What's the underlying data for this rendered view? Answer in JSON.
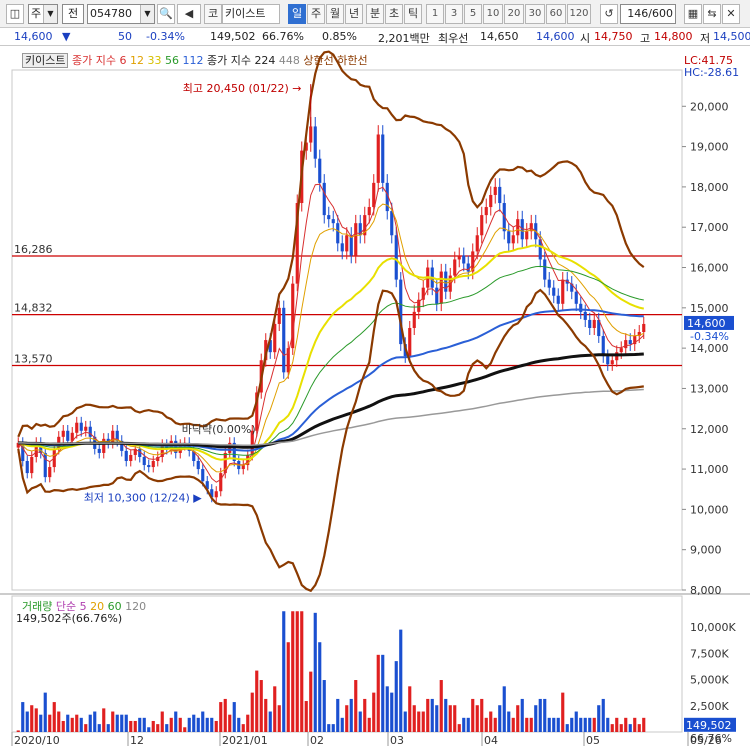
{
  "toolbar": {
    "icon_chart": "◫",
    "mode": "주",
    "cat": "전",
    "code": "054780",
    "search_icon": "🔍",
    "speaker": "◀",
    "exchange_btn": "코",
    "chart_name": "키이스트",
    "periods": [
      "일",
      "주",
      "월",
      "년",
      "분",
      "초",
      "틱"
    ],
    "selected_period": "일",
    "nums": [
      "1",
      "3",
      "5",
      "10",
      "20",
      "30",
      "60",
      "120"
    ],
    "count": "146",
    "count_total": "/600",
    "tool_icons": [
      "▦",
      "⇆",
      "✕",
      "▣"
    ]
  },
  "quote": {
    "price": "14,600",
    "change": "50",
    "rate": "-0.34%",
    "volume": "149,502",
    "vol_ratio": "66.76%",
    "rate2": "0.85%",
    "amount": "2,201백만",
    "best_ask_label": "최우선",
    "best_ask": "14,650",
    "best_bid": "14,600",
    "open_label": "시",
    "open": "14,750",
    "high_label": "고",
    "high": "14,800",
    "low_label": "저",
    "low": "14,500"
  },
  "chart_data": [
    {
      "type": "candlestick",
      "title": "키이스트",
      "legend": [
        {
          "text": "종가 지수 6",
          "color": "#d83030"
        },
        {
          "text": "12",
          "color": "#e0a000"
        },
        {
          "text": "33",
          "color": "#d6c000"
        },
        {
          "text": "56",
          "color": "#2a9a2a"
        },
        {
          "text": "112",
          "color": "#2a5fd6"
        },
        {
          "text": "종가 지수 224",
          "color": "#222222"
        },
        {
          "text": "448",
          "color": "#888888"
        },
        {
          "text": "상한선",
          "color": "#8b3a00"
        },
        {
          "text": "하한선",
          "color": "#8b3a00"
        }
      ],
      "y_ticks": [
        20000,
        19000,
        18000,
        17000,
        16000,
        15000,
        14000,
        13000,
        12000,
        11000,
        10000,
        9000,
        8000
      ],
      "y_tick_labels": [
        "20,000",
        "19,000",
        "18,000",
        "17,000",
        "16,000",
        "15,000",
        "14,000",
        "13,000",
        "12,000",
        "11,000",
        "10,000",
        "9,000",
        "8,000"
      ],
      "ylim": [
        8000,
        20900
      ],
      "x_labels": [
        "2020/10",
        "12",
        "2021/01",
        "02",
        "03",
        "04",
        "05",
        "05/26"
      ],
      "hlines": [
        {
          "value": 16286,
          "label": "16,286",
          "color": "#cc0000"
        },
        {
          "value": 14832,
          "label": "14,832",
          "color": "#cc0000"
        },
        {
          "value": 13570,
          "label": "13,570",
          "color": "#cc0000"
        }
      ],
      "lc_label": "LC:41.75",
      "hc_label": "HC:-28.61",
      "last_price": "14,600",
      "last_rate": "-0.34%",
      "high_annotation": "최고 20,450 (01/22)",
      "low_annotation": "최저 10,300 (12/24)",
      "bottom_annotation": "바닥략(0.00%)",
      "series_price": [
        11650,
        11200,
        10900,
        11300,
        11650,
        11400,
        10800,
        11050,
        11500,
        11800,
        11950,
        11700,
        11900,
        12150,
        11950,
        12050,
        11800,
        11500,
        11400,
        11750,
        11650,
        11950,
        11700,
        11450,
        11200,
        11350,
        11500,
        11300,
        11100,
        11050,
        11200,
        11300,
        11600,
        11500,
        11700,
        11400,
        11600,
        11650,
        11450,
        11200,
        11000,
        10700,
        10500,
        10300,
        10450,
        10900,
        11400,
        11650,
        11200,
        11000,
        11100,
        11350,
        11950,
        12900,
        13700,
        14200,
        13900,
        14600,
        15000,
        13400,
        14000,
        15600,
        17600,
        18900,
        19100,
        19500,
        18700,
        18100,
        17300,
        17200,
        17100,
        16600,
        16400,
        16800,
        16300,
        17100,
        16800,
        17300,
        17500,
        18100,
        19300,
        18100,
        17400,
        16800,
        15700,
        14100,
        13800,
        14500,
        14900,
        15200,
        15500,
        16000,
        15500,
        15100,
        15900,
        15400,
        15800,
        16200,
        16300,
        16100,
        15900,
        16400,
        16800,
        17300,
        17500,
        17800,
        18000,
        17600,
        16900,
        16600,
        16800,
        17200,
        16700,
        16900,
        17100,
        16700,
        16200,
        15700,
        15500,
        15300,
        15100,
        15700,
        15600,
        15400,
        15100,
        14900,
        14700,
        14500,
        14700,
        14300,
        13800,
        13600,
        13700,
        13900,
        14000,
        14200,
        14100,
        14300,
        14400,
        14600
      ]
    },
    {
      "type": "bar",
      "title": "거래량",
      "legend": [
        {
          "text": "단순 5",
          "color": "#b040b0"
        },
        {
          "text": "20",
          "color": "#e0a000"
        },
        {
          "text": "60",
          "color": "#2a9a2a"
        },
        {
          "text": "120",
          "color": "#888888"
        }
      ],
      "value_label": "149,502주(66.76%)",
      "y_ticks": [
        10000,
        7500,
        5000,
        2500
      ],
      "y_tick_labels": [
        "10,000K",
        "7,500K",
        "5,000K",
        "2,500K"
      ],
      "ylim": [
        0,
        12000
      ],
      "last_value": "149,502",
      "last_ratio": "66.76%"
    }
  ]
}
